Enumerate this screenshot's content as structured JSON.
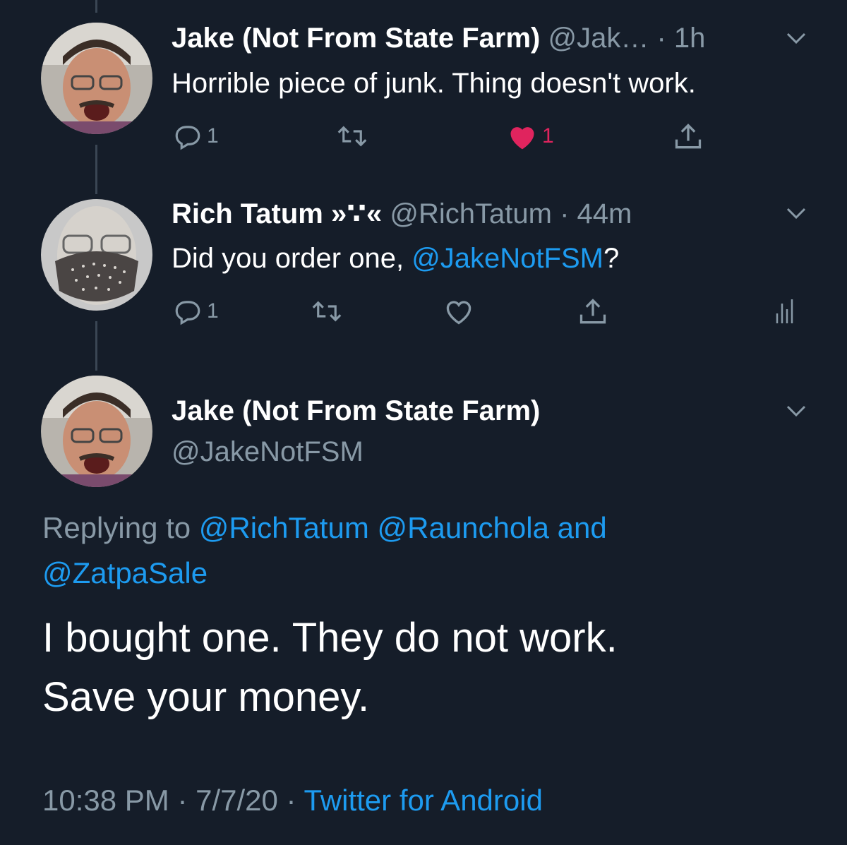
{
  "tweets": [
    {
      "name": "Jake (Not From State Farm)",
      "handle": "@Jak…",
      "sep": " · ",
      "time": "1h",
      "text": "Horrible piece of junk. Thing doesn't work.",
      "reply_count": "1",
      "like_count": "1"
    },
    {
      "name": "Rich Tatum »∵«",
      "handle": "@RichTatum",
      "sep": " · ",
      "time": "44m",
      "text_before": "Did you order one, ",
      "mention": "@JakeNotFSM",
      "text_after": "?",
      "reply_count": "1"
    }
  ],
  "main_tweet": {
    "name": "Jake (Not From State Farm)",
    "handle": "@JakeNotFSM",
    "replying_prefix": "Replying to ",
    "mentions": [
      "@RichTatum",
      "@Raunchola",
      "and",
      "@ZatpaSale"
    ],
    "text_line1": "I bought one. They do not work.",
    "text_line2": "Save your money.",
    "time": "10:38 PM",
    "sep": " · ",
    "date": "7/7/20",
    "sep2": " · ",
    "source": "Twitter for Android"
  },
  "colors": {
    "background": "#151d29",
    "link": "#1d9bf0",
    "muted": "#8899a6",
    "like": "#e0245e"
  },
  "icons": [
    "reply-icon",
    "retweet-icon",
    "like-icon",
    "share-icon",
    "analytics-icon",
    "chevron-down-icon"
  ]
}
